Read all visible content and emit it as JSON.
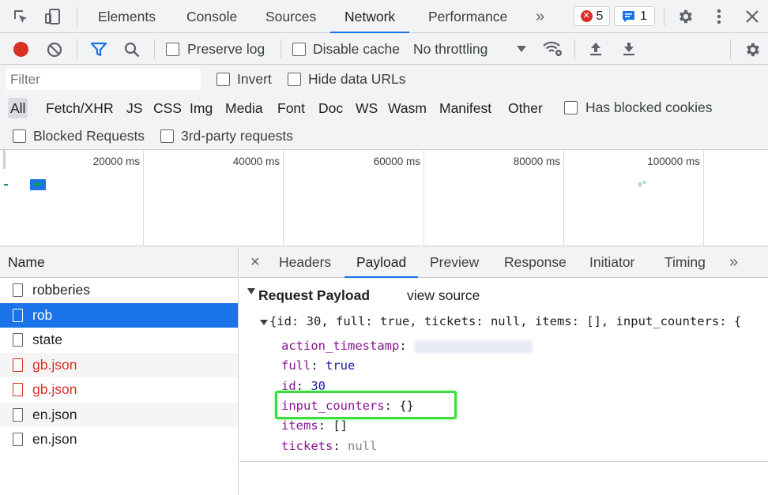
{
  "toolbar": {
    "tabs": [
      "Elements",
      "Console",
      "Sources",
      "Network",
      "Performance"
    ],
    "more": "»",
    "errors_count": "5",
    "messages_count": "1"
  },
  "network_bar": {
    "preserve_log": "Preserve log",
    "disable_cache": "Disable cache",
    "throttling": "No throttling"
  },
  "filter": {
    "placeholder": "Filter",
    "invert": "Invert",
    "hide_data_urls": "Hide data URLs"
  },
  "types": [
    "All",
    "Fetch/XHR",
    "JS",
    "CSS",
    "Img",
    "Media",
    "Font",
    "Doc",
    "WS",
    "Wasm",
    "Manifest",
    "Other"
  ],
  "has_blocked_cookies": "Has blocked cookies",
  "blocked_requests": "Blocked Requests",
  "third_party": "3rd-party requests",
  "overview": {
    "ticks": [
      "20000 ms",
      "40000 ms",
      "60000 ms",
      "80000 ms",
      "100000 ms"
    ]
  },
  "requests": {
    "header": "Name",
    "items": [
      {
        "name": "robberies",
        "state": "normal"
      },
      {
        "name": "rob",
        "state": "selected"
      },
      {
        "name": "state",
        "state": "normal"
      },
      {
        "name": "gb.json",
        "state": "error"
      },
      {
        "name": "gb.json",
        "state": "error"
      },
      {
        "name": "en.json",
        "state": "normal"
      },
      {
        "name": "en.json",
        "state": "normal"
      }
    ]
  },
  "detail": {
    "close": "×",
    "tabs": [
      "Headers",
      "Payload",
      "Preview",
      "Response",
      "Initiator",
      "Timing"
    ],
    "more": "»",
    "section_title": "Request Payload",
    "view_source": "view source",
    "summary": "{id: 30, full: true, tickets: null, items: [], input_counters: {",
    "fields": [
      {
        "key": "action_timestamp",
        "value": ""
      },
      {
        "key": "full",
        "value": "true"
      },
      {
        "key": "id",
        "value": "30"
      },
      {
        "key": "input_counters",
        "value": "{}"
      },
      {
        "key": "items",
        "value": "[]"
      },
      {
        "key": "tickets",
        "value": "null"
      }
    ]
  },
  "colors": {
    "accent": "#1a73e8",
    "record": "#d93025",
    "highlight": "#3ddc3d"
  }
}
